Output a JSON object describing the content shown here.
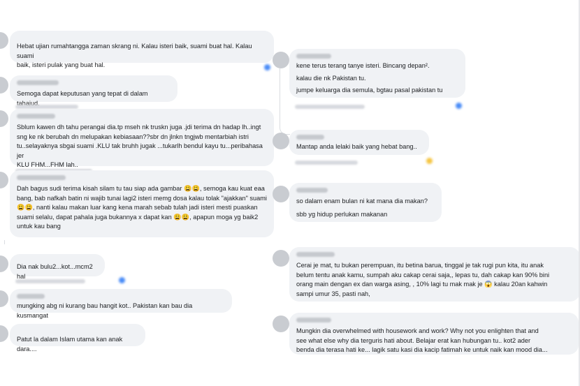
{
  "left_comments": [
    {
      "text": "Hebat ujian rumahtangga zaman skrang ni. Kalau isteri baik, suami buat hal. Kalau suami\nbaik, isteri pulak yang buat hal."
    },
    {
      "text": "Semoga dapat keputusan yang tepat di dalam tahajud."
    },
    {
      "text": "Sblum kawen dh tahu perangai dia.tp mseh nk truskn juga .jdi terima dn hadap lh..ingt\nsng ke nk berubah dn melupakan kebiasaan??sbr dn jlnkn tngjwb mentarbiah istri\ntu..selayaknya sbgai suami .KLU tak bruhh jugak ...tukarlh bendul kayu tu...peribahasa jer\nKLU FHM...FHM lah.."
    },
    {
      "text": "Dah bagus sudi terima kisah silam tu tau siap ada gambar 😩😩, semoga kau kuat eaa\nbang, bab nafkah batin ni wajib tunai lagi2 isteri memg dosa kalau tolak \"ajakkan\" suami\n😩😩, nanti kalau makan luar kang kena marah sebab tulah jadi isteri mesti puaskan\nsuami selalu, dapat pahala juga bukannya x dapat kan 😩😩, apapun moga yg baik2\nuntuk kau bang"
    },
    {
      "text": "Dia nak bulu2...kot...mcm2 hal"
    },
    {
      "text": "mungking abg ni kurang bau hangit kot.. Pakistan kan bau dia kusmangat"
    },
    {
      "text": "Patut la dalam Islam utama kan anak dara...."
    }
  ],
  "right_comments": [
    {
      "lines": [
        "kene terus terang tanye isteri. Bincang depan².",
        "kalau die nk Pakistan tu.",
        "jumpe keluarga dia semula, bgtau pasal pakistan tu"
      ]
    },
    {
      "lines": [
        "Mantap anda lelaki baik yang hebat bang.."
      ]
    },
    {
      "lines": [
        "so dalam enam bulan ni kat mana dia makan?",
        "sbb yg hidup perlukan makanan"
      ]
    },
    {
      "lines": [
        "Cerai je mat, tu bukan perempuan, itu betina barua, tinggal je tak rugi pun kita, itu anak\nbelum tentu anak kamu, sumpah aku cakap cerai saja,, lepas tu, dah cakap kan 90% bini\norang main dengan ex dan warga asing, , 10% lagi tu mak mak je 😱 kalau 20an kahwin\nsampi umur 35, pasti nah,"
      ]
    },
    {
      "lines": [
        "Mungkin dia overwhelmed with housework and work? Why not you enlighten that and\nsee what else why dia terguris hati about. Belajar erat kan hubungan tu.. kot2 ader\nbenda dia terasa hati ke... lagik satu kasi dia kacip fatimah ke untuk naik kan mood dia..."
      ]
    }
  ],
  "colors": {
    "bubble": "#f0f2f5",
    "text": "#1c1e21",
    "reaction": "#4a8cf7"
  }
}
